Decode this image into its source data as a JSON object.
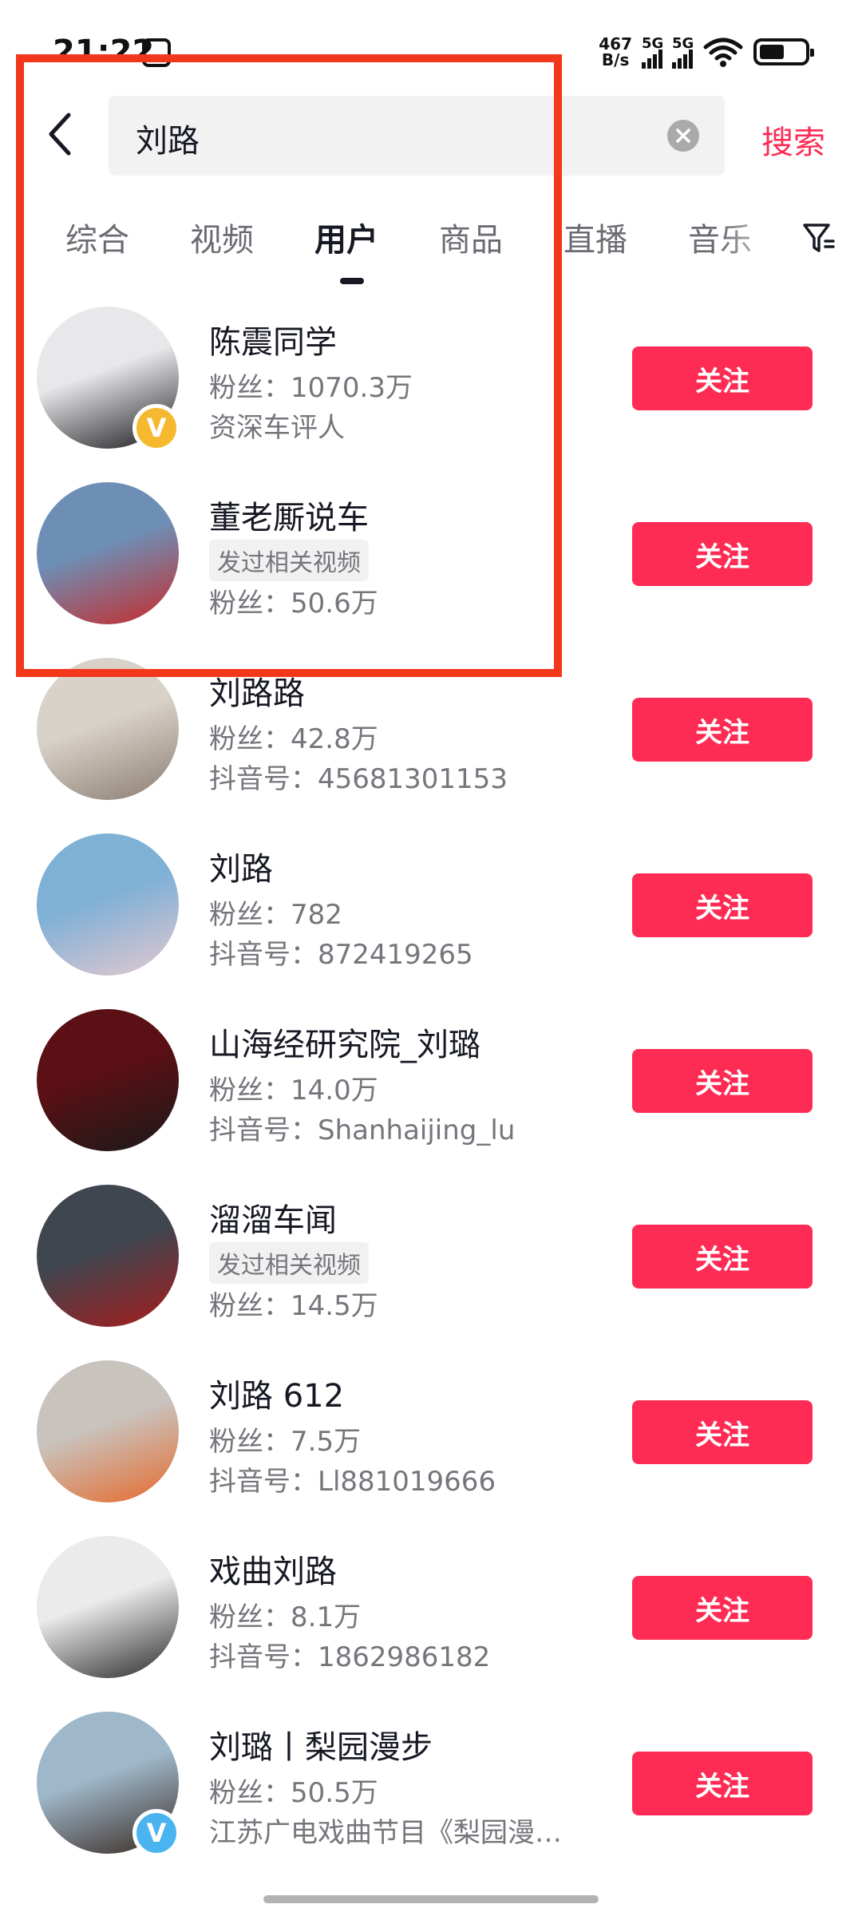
{
  "status_bar": {
    "time": "21:22",
    "net_speed_value": "467",
    "net_speed_unit": "B/s",
    "signal1_label": "5G",
    "signal2_label": "5G"
  },
  "search": {
    "query": "刘路",
    "submit_label": "搜索"
  },
  "tabs": [
    {
      "label": "综合",
      "active": false
    },
    {
      "label": "视频",
      "active": false
    },
    {
      "label": "用户",
      "active": true
    },
    {
      "label": "商品",
      "active": false
    },
    {
      "label": "直播",
      "active": false
    },
    {
      "label": "音乐",
      "active": false
    }
  ],
  "users": [
    {
      "name": "陈震同学",
      "line1": "粉丝：1070.3万",
      "line2": "资深车评人",
      "tag": "",
      "verified": "gold",
      "follow": "关注",
      "avatar_colors": [
        "#e8e8ea",
        "#1b1b1d"
      ]
    },
    {
      "name": "董老厮说车",
      "line1": "",
      "line2": "粉丝：50.6万",
      "tag": "发过相关视频",
      "verified": "",
      "follow": "关注",
      "avatar_colors": [
        "#6d8fb6",
        "#c82a2a"
      ]
    },
    {
      "name": "刘路路",
      "line1": "粉丝：42.8万",
      "line2": "抖音号：45681301153",
      "tag": "",
      "verified": "",
      "follow": "关注",
      "avatar_colors": [
        "#d9d2c9",
        "#8b7d72"
      ]
    },
    {
      "name": "刘路",
      "line1": "粉丝：782",
      "line2": "抖音号：872419265",
      "tag": "",
      "verified": "",
      "follow": "关注",
      "avatar_colors": [
        "#7fb0d6",
        "#e4c8cf"
      ]
    },
    {
      "name": "山海经研究院_刘璐",
      "line1": "粉丝：14.0万",
      "line2": "抖音号：Shanhaijing_lu",
      "tag": "",
      "verified": "",
      "follow": "关注",
      "avatar_colors": [
        "#5a1014",
        "#1a1a1a"
      ]
    },
    {
      "name": "溜溜车闻",
      "line1": "",
      "line2": "粉丝：14.5万",
      "tag": "发过相关视频",
      "verified": "",
      "follow": "关注",
      "avatar_colors": [
        "#3f4650",
        "#a51c1c"
      ]
    },
    {
      "name": "刘路 612",
      "line1": "粉丝：7.5万",
      "line2": "抖音号：Ll881019666",
      "tag": "",
      "verified": "",
      "follow": "关注",
      "avatar_colors": [
        "#c9c3be",
        "#e66a2c"
      ]
    },
    {
      "name": "戏曲刘路",
      "line1": "粉丝：8.1万",
      "line2": "抖音号：1862986182",
      "tag": "",
      "verified": "",
      "follow": "关注",
      "avatar_colors": [
        "#ebebeb",
        "#2a2a2a"
      ]
    },
    {
      "name": "刘璐丨梨园漫步",
      "line1": "粉丝：50.5万",
      "line2": "江苏广电戏曲节目《梨园漫…",
      "tag": "",
      "verified": "blue",
      "follow": "关注",
      "avatar_colors": [
        "#9eb7c9",
        "#3a2a22"
      ]
    }
  ],
  "colors": {
    "accent": "#fe2c55",
    "highlight": "#f2371a",
    "badge_gold": "#f5b82e",
    "badge_blue": "#49b4f0"
  }
}
